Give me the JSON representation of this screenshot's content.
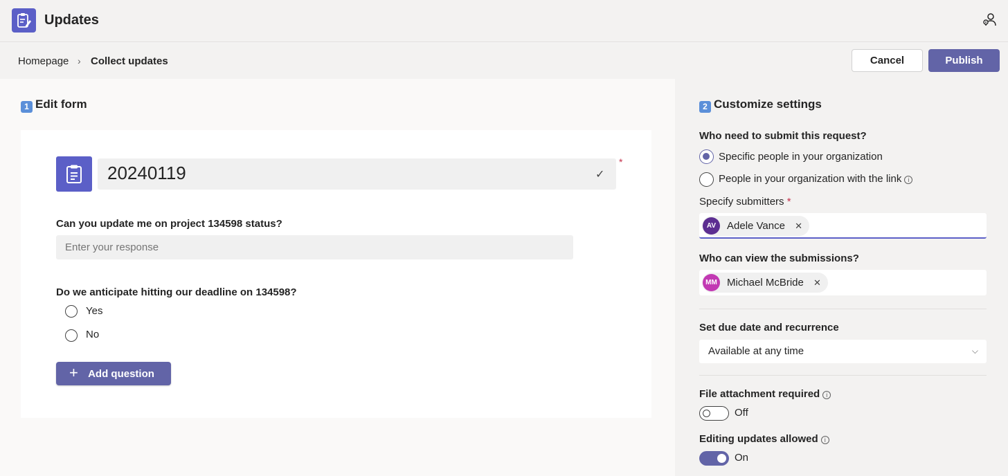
{
  "app": {
    "title": "Updates"
  },
  "breadcrumb": {
    "home": "Homepage",
    "separator": "›",
    "current": "Collect updates"
  },
  "actions": {
    "cancel_label": "Cancel",
    "publish_label": "Publish"
  },
  "edit_form": {
    "step_badge": "1",
    "heading": "Edit form",
    "form_title": "20240119",
    "required_mark": "*",
    "question1": {
      "label": "Can you update me on project 134598 status?",
      "placeholder": "Enter your response"
    },
    "question2": {
      "label": "Do we anticipate hitting our deadline on 134598?",
      "options": [
        "Yes",
        "No"
      ]
    },
    "add_question_label": "Add question"
  },
  "settings": {
    "step_badge": "2",
    "heading": "Customize settings",
    "who_submit": {
      "label": "Who need to submit this request?",
      "options": [
        "Specific people in your organization",
        "People in your organization with the link"
      ],
      "selected_index": 0
    },
    "specify_submitters": {
      "label": "Specify submitters",
      "required_mark": "*",
      "people": [
        {
          "initials": "AV",
          "name": "Adele Vance",
          "color": "#5c2e91"
        }
      ]
    },
    "who_view": {
      "label": "Who can view the submissions?",
      "people": [
        {
          "initials": "MM",
          "name": "Michael McBride",
          "color": "#c239b3"
        }
      ]
    },
    "due_date": {
      "label": "Set due date and recurrence",
      "value": "Available at any time"
    },
    "file_attachment": {
      "label": "File attachment required",
      "state": "Off"
    },
    "editing_updates": {
      "label": "Editing updates allowed",
      "state": "On"
    }
  },
  "colors": {
    "brand": "#6264a7",
    "app_icon": "#5b5fc7",
    "required": "#c4314b"
  }
}
